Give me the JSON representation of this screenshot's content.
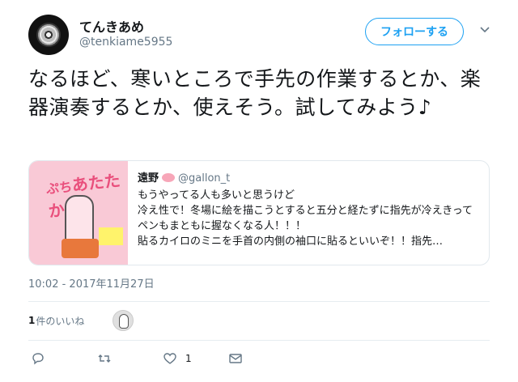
{
  "user": {
    "name": "てんきあめ",
    "handle": "@tenkiame5955",
    "follow_label": "フォローする"
  },
  "tweet": {
    "text": "なるほど、寒いところで手先の作業するとか、楽器演奏するとか、使えそう。試してみよう♪"
  },
  "quoted": {
    "name": "遠野",
    "handle": "@gallon_t",
    "lines": [
      "もうやってる人も多いと思うけど",
      "冷え性で！冬場に絵を描こうとすると五分と経たずに指先が冷えきってペンもまともに握なくなる人！！！",
      "貼るカイロのミニを手首の内側の袖口に貼るといいぞ！！指先…"
    ],
    "image_title": "ぷちあたたかい"
  },
  "timestamp": "10:02 - 2017年11月27日",
  "likes": {
    "count": "1",
    "label": "件のいいね"
  },
  "actions": {
    "like_count": "1"
  },
  "colors": {
    "accent": "#1da1f2",
    "muted": "#657786",
    "border": "#e1e8ed"
  },
  "icons": {
    "reply": "reply-icon",
    "retweet": "retweet-icon",
    "like": "heart-icon",
    "dm": "envelope-icon",
    "more": "chevron-down-icon"
  }
}
